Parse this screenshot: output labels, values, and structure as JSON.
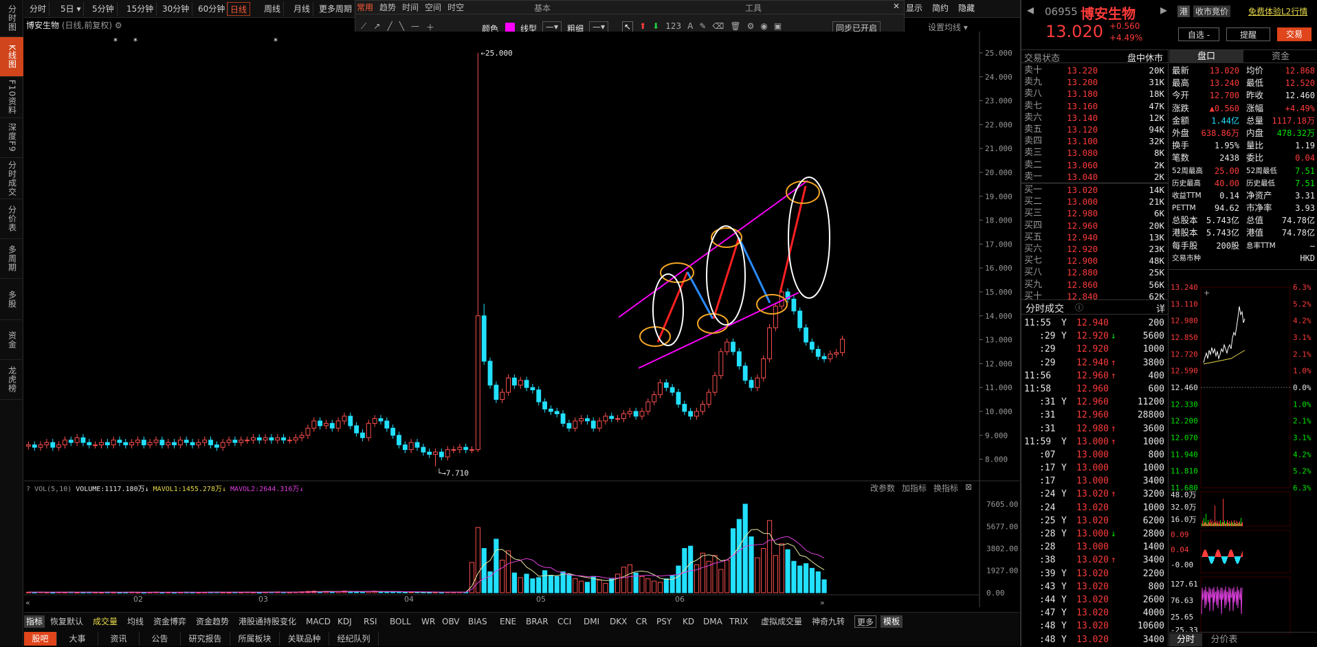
{
  "left_nav": [
    {
      "label": "分时图"
    },
    {
      "label": "K线图"
    },
    {
      "label": "F10资料"
    },
    {
      "label": "深度F9"
    },
    {
      "label": "分时成交"
    },
    {
      "label": "分价表"
    },
    {
      "label": "多周期"
    },
    {
      "label": "多股"
    },
    {
      "label": "资金"
    },
    {
      "label": "龙虎榜"
    }
  ],
  "period_tabs": [
    "分时",
    "5日 ▾",
    "5分钟",
    "15分钟",
    "30分钟",
    "60分钟",
    "日线",
    "周线",
    "月线",
    "更多周期"
  ],
  "draw_toolbar": {
    "tabs": [
      "常用",
      "趋势",
      "时间",
      "空间",
      "时空"
    ],
    "sections": {
      "basic": "基本",
      "tools": "工具"
    },
    "color_label": "颜色",
    "line_type_label": "线型",
    "line_width_label": "粗细",
    "sync_label": "同步已开启",
    "color": "#ff00ff"
  },
  "chart_header": {
    "name": "博安生物",
    "mode": "(日线,前复权)"
  },
  "top_right_btns": [
    "显示",
    "简约",
    "隐藏"
  ],
  "settings": {
    "ma_label": "设置均线 ▾"
  },
  "price_axis": [
    "25.000",
    "24.000",
    "23.000",
    "22.000",
    "21.000",
    "20.000",
    "19.000",
    "18.000",
    "17.000",
    "16.000",
    "15.000",
    "14.000",
    "13.000",
    "12.000",
    "11.000",
    "10.000",
    "9.000",
    "8.000"
  ],
  "annotations": {
    "high": "25.000",
    "low": "7.710"
  },
  "vol_header": {
    "label": "VOL(5,10)",
    "volume": "VOLUME:1117.180万",
    "mavol1": "MAVOL1:1455.278万",
    "mavol2": "MAVOL2:2644.316万",
    "tools": [
      "改参数",
      "加指标",
      "换指标"
    ]
  },
  "vol_axis": [
    "7605.00",
    "5677.00",
    "3802.00",
    "1927.00",
    "0.00"
  ],
  "x_labels": [
    "02",
    "03",
    "04",
    "05",
    "06"
  ],
  "indicator_tabs": [
    "指标",
    "恢复默认",
    "成交量",
    "均线",
    "资金博弈",
    "资金趋势",
    "港股通持股变化",
    "MACD",
    "KDJ",
    "RSI",
    "BOLL",
    "WR",
    "OBV",
    "BIAS",
    "ENE",
    "BRAR",
    "CCI",
    "DMI",
    "DKX",
    "CR",
    "PSY",
    "KD",
    "DMA",
    "TRIX",
    "虚拟成交量",
    "神奇九转",
    "更多",
    "模板"
  ],
  "news_tabs": [
    "股吧",
    "大事",
    "资讯",
    "公告",
    "研究报告",
    "所属板块",
    "关联品种",
    "经纪队列"
  ],
  "quote": {
    "code": "06955",
    "name": "博安生物",
    "price": "13.020",
    "change": "+0.560",
    "pct": "+4.49%",
    "tags": [
      "港",
      "收市竞价"
    ],
    "l2": "免费体验L2行情",
    "btns": [
      "自选 -",
      "提醒",
      "交易"
    ]
  },
  "order_book": {
    "title": "交易状态",
    "status": "盘中休市",
    "asks": [
      [
        "卖十",
        "13.220",
        "20K"
      ],
      [
        "卖九",
        "13.200",
        "31K"
      ],
      [
        "卖八",
        "13.180",
        "18K"
      ],
      [
        "卖七",
        "13.160",
        "47K"
      ],
      [
        "卖六",
        "13.140",
        "12K"
      ],
      [
        "卖五",
        "13.120",
        "94K"
      ],
      [
        "卖四",
        "13.100",
        "32K"
      ],
      [
        "卖三",
        "13.080",
        "8K"
      ],
      [
        "卖二",
        "13.060",
        "2K"
      ],
      [
        "卖一",
        "13.040",
        "2K"
      ]
    ],
    "bids": [
      [
        "买一",
        "13.020",
        "14K"
      ],
      [
        "买二",
        "13.000",
        "21K"
      ],
      [
        "买三",
        "12.980",
        "6K"
      ],
      [
        "买四",
        "12.960",
        "20K"
      ],
      [
        "买五",
        "12.940",
        "13K"
      ],
      [
        "买六",
        "12.920",
        "23K"
      ],
      [
        "买七",
        "12.900",
        "48K"
      ],
      [
        "买八",
        "12.880",
        "25K"
      ],
      [
        "买九",
        "12.860",
        "56K"
      ],
      [
        "买十",
        "12.840",
        "62K"
      ]
    ]
  },
  "panel_tabs": [
    "盘口",
    "资金"
  ],
  "stats": [
    [
      "最新",
      "13.020",
      "均价",
      "12.868"
    ],
    [
      "最高",
      "13.240",
      "最低",
      "12.520"
    ],
    [
      "今开",
      "12.700",
      "昨收",
      "12.460"
    ],
    [
      "涨跌",
      "▲0.560",
      "涨幅",
      "+4.49%"
    ],
    [
      "金额",
      "1.44亿",
      "总量",
      "1117.18万"
    ],
    [
      "外盘",
      "638.86万",
      "内盘",
      "478.32万"
    ],
    [
      "换手",
      "1.95%",
      "量比",
      "1.19"
    ],
    [
      "笔数",
      "2438",
      "委比",
      "0.04"
    ],
    [
      "52周最高",
      "25.00",
      "52周最低",
      "7.51"
    ],
    [
      "历史最高",
      "40.00",
      "历史最低",
      "7.51"
    ],
    [
      "收益TTM",
      "0.14",
      "净资产",
      "3.31"
    ],
    [
      "PETTM",
      "94.62",
      "市净率",
      "3.93"
    ],
    [
      "总股本",
      "5.743亿",
      "总值",
      "74.78亿"
    ],
    [
      "港股本",
      "5.743亿",
      "港值",
      "74.78亿"
    ],
    [
      "每手股",
      "200股",
      "息率TTM",
      "—"
    ],
    [
      "交易市种",
      "",
      "",
      "HKD"
    ]
  ],
  "ticks_title": "分时成交",
  "ticks_detail": "详",
  "ticks": [
    [
      "11:55",
      "Y",
      "12.940",
      "",
      "200"
    ],
    [
      ":29",
      "Y",
      "12.920",
      "↓",
      "5600"
    ],
    [
      ":29",
      "",
      "12.920",
      "",
      "1000"
    ],
    [
      ":29",
      "",
      "12.940",
      "↑",
      "3800"
    ],
    [
      "11:56",
      "",
      "12.960",
      "↑",
      "400"
    ],
    [
      "11:58",
      "",
      "12.960",
      "",
      "600"
    ],
    [
      ":31",
      "Y",
      "12.960",
      "",
      "11200"
    ],
    [
      ":31",
      "",
      "12.960",
      "",
      "28800"
    ],
    [
      ":31",
      "",
      "12.980",
      "↑",
      "3600"
    ],
    [
      "11:59",
      "Y",
      "13.000",
      "↑",
      "1000"
    ],
    [
      ":07",
      "",
      "13.000",
      "",
      "800"
    ],
    [
      ":17",
      "Y",
      "13.000",
      "",
      "1000"
    ],
    [
      ":17",
      "",
      "13.000",
      "",
      "3400"
    ],
    [
      ":24",
      "Y",
      "13.020",
      "↑",
      "3200"
    ],
    [
      ":24",
      "",
      "13.020",
      "",
      "1000"
    ],
    [
      ":25",
      "Y",
      "13.020",
      "",
      "6200"
    ],
    [
      ":28",
      "Y",
      "13.000",
      "↓",
      "2800"
    ],
    [
      ":28",
      "",
      "13.000",
      "",
      "1400"
    ],
    [
      ":38",
      "",
      "13.020",
      "↑",
      "3400"
    ],
    [
      ":39",
      "Y",
      "13.020",
      "",
      "2200"
    ],
    [
      ":43",
      "Y",
      "13.020",
      "",
      "800"
    ],
    [
      ":44",
      "Y",
      "13.020",
      "",
      "2600"
    ],
    [
      ":47",
      "Y",
      "13.020",
      "",
      "4000"
    ],
    [
      ":48",
      "Y",
      "13.020",
      "",
      "10600"
    ],
    [
      ":48",
      "Y",
      "13.020",
      "",
      "3400"
    ]
  ],
  "mini_axis_left": [
    "13.240",
    "13.110",
    "12.980",
    "12.850",
    "12.720",
    "12.590",
    "12.460",
    "12.330",
    "12.200",
    "12.070",
    "11.940",
    "11.810",
    "11.680"
  ],
  "mini_axis_right": [
    "6.3%",
    "5.2%",
    "4.2%",
    "3.1%",
    "2.1%",
    "1.0%",
    "0.0%",
    "1.0%",
    "2.1%",
    "3.1%",
    "4.2%",
    "5.2%",
    "6.3%"
  ],
  "mini_vol_axis": [
    "48.0万",
    "32.0万",
    "16.0万"
  ],
  "mini_ind_axis": [
    "0.09",
    "0.04",
    "-0.00",
    "127.61",
    "76.63",
    "25.65",
    "-25.33"
  ],
  "mini_tabs": [
    "分时",
    "分价表"
  ],
  "chart_data": {
    "type": "candlestick",
    "x_labels": [
      "02",
      "03",
      "04",
      "05",
      "06"
    ],
    "ylim": [
      7.5,
      25.2
    ],
    "closes": [
      8.6,
      8.5,
      8.6,
      8.7,
      8.5,
      8.6,
      8.8,
      8.7,
      8.9,
      8.7,
      8.6,
      8.6,
      8.7,
      8.6,
      8.8,
      8.7,
      8.6,
      8.7,
      8.8,
      8.6,
      8.7,
      8.8,
      8.6,
      8.7,
      8.6,
      8.8,
      8.7,
      8.6,
      8.7,
      8.8,
      8.6,
      8.5,
      8.7,
      8.8,
      8.7,
      8.8,
      8.8,
      8.9,
      8.8,
      8.9,
      8.8,
      8.9,
      8.8,
      8.8,
      8.9,
      9.0,
      9.3,
      9.6,
      9.4,
      9.5,
      9.3,
      9.6,
      9.8,
      9.4,
      9.1,
      8.9,
      9.5,
      9.7,
      9.6,
      9.3,
      9.0,
      8.6,
      8.4,
      8.7,
      8.5,
      8.3,
      8.2,
      8.3,
      8.1,
      8.4,
      8.4,
      8.5,
      8.4,
      8.4,
      14.0,
      12.1,
      11.1,
      10.5,
      10.8,
      11.4,
      11.1,
      11.3,
      11.0,
      10.9,
      10.4,
      10.1,
      10.0,
      9.9,
      9.5,
      9.3,
      9.6,
      9.7,
      9.6,
      9.3,
      9.6,
      9.8,
      9.7,
      9.7,
      9.9,
      10.0,
      9.8,
      10.0,
      10.4,
      10.7,
      11.2,
      11.0,
      10.8,
      10.3,
      10.0,
      9.8,
      10.0,
      10.3,
      10.8,
      11.5,
      12.5,
      12.9,
      12.5,
      11.9,
      11.3,
      11.0,
      11.4,
      12.2,
      13.5,
      14.4,
      15.0,
      14.7,
      14.2,
      13.5,
      12.9,
      12.6,
      12.3,
      12.2,
      12.4,
      12.46,
      13.02
    ],
    "volume_wan": [
      50,
      40,
      60,
      40,
      30,
      50,
      40,
      60,
      30,
      40,
      50,
      40,
      30,
      50,
      40,
      30,
      40,
      50,
      40,
      30,
      40,
      50,
      30,
      40,
      30,
      40,
      50,
      40,
      30,
      40,
      50,
      60,
      40,
      30,
      50,
      40,
      60,
      40,
      30,
      50,
      60,
      70,
      50,
      40,
      60,
      80,
      120,
      140,
      90,
      110,
      80,
      100,
      150,
      110,
      90,
      70,
      120,
      140,
      100,
      90,
      80,
      60,
      50,
      70,
      60,
      50,
      40,
      50,
      40,
      60,
      50,
      60,
      50,
      2600,
      5600,
      3800,
      1800,
      4600,
      2800,
      3600,
      1700,
      1300,
      1600,
      1200,
      1300,
      1900,
      1500,
      1400,
      1800,
      1600,
      1200,
      1000,
      900,
      1400,
      1100,
      800,
      1200,
      1600,
      2200,
      2400,
      1700,
      1400,
      1200,
      1000,
      900,
      1200,
      1500,
      2300,
      3800,
      4000,
      2400,
      3400,
      2700,
      3200,
      2000,
      2800,
      5500,
      6300,
      7605,
      4800,
      3000,
      3800,
      6200,
      3200,
      4200,
      3700,
      2700,
      2300,
      2500,
      2100,
      1800,
      1117
    ]
  }
}
